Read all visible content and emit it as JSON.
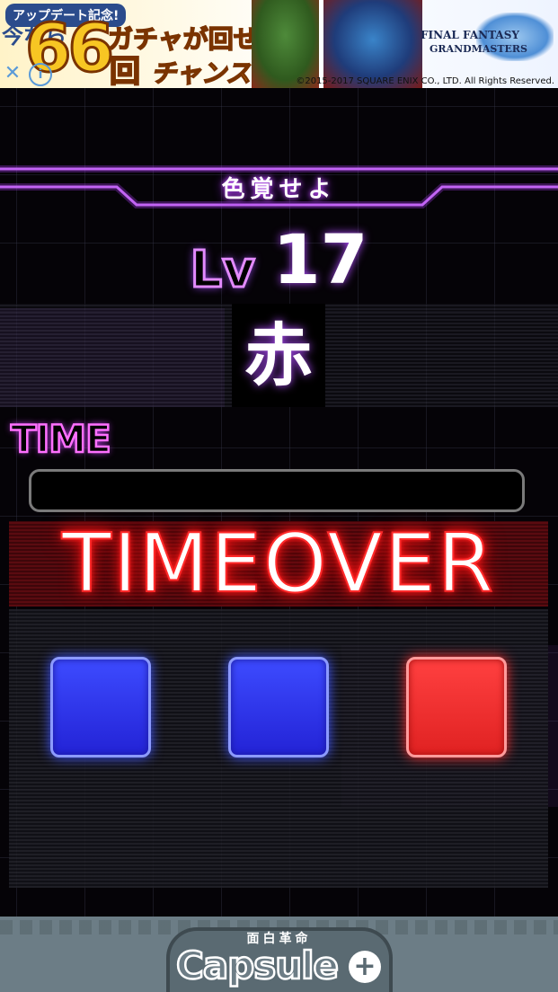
{
  "ad": {
    "tag": "アップデート記念!",
    "prefix": "今なら",
    "big_number": "66",
    "unit": "回",
    "line1": "ガチャが回せる",
    "line2": "チャンス!!",
    "brand_line1": "FINAL FANTASY",
    "brand_line2": "GRANDMASTERS",
    "copyright": "©2015-2017 SQUARE ENIX CO., LTD. All Rights Reserved.",
    "close_symbol": "✕",
    "info_symbol": "i"
  },
  "game": {
    "title": "色覚せよ",
    "level_label": "Lv",
    "level_value": "17",
    "color_word": "赤",
    "time_label": "TIME",
    "time_remaining_fraction": 0,
    "status_text": "TIMEOVER",
    "buttons": [
      {
        "color": "blue",
        "hex": "#2b33e8"
      },
      {
        "color": "blue",
        "hex": "#2b33e8"
      },
      {
        "color": "red",
        "hex": "#f03333"
      }
    ]
  },
  "footer": {
    "subtitle": "面白革命",
    "brand": "Capsule",
    "plus": "+"
  }
}
